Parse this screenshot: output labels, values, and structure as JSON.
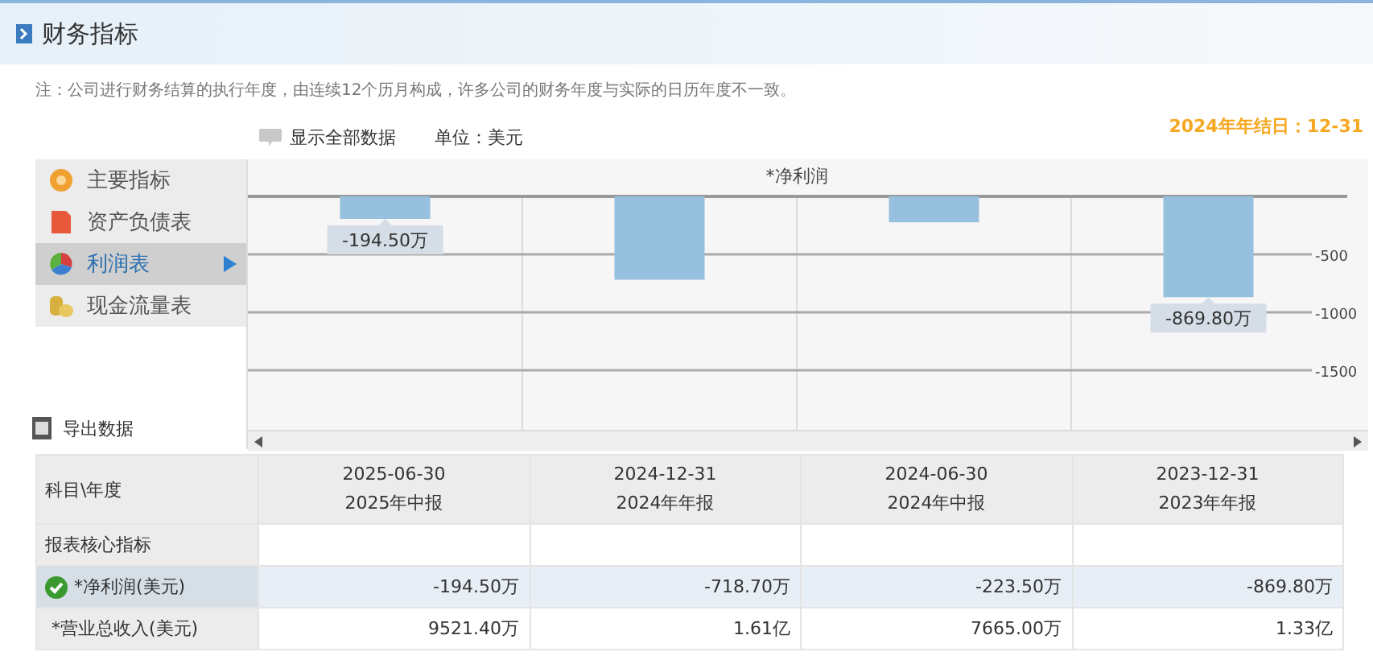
{
  "header": {
    "title": "财务指标"
  },
  "note": "注：公司进行财务结算的执行年度，由连续12个历月构成，许多公司的财务年度与实际的日历年度不一致。",
  "toolbar": {
    "show_all": "显示全部数据",
    "unit": "单位：美元",
    "year_end": "2024年年结日：12-31"
  },
  "sidebar": {
    "items": [
      {
        "label": "主要指标",
        "selected": false
      },
      {
        "label": "资产负债表",
        "selected": false
      },
      {
        "label": "利润表",
        "selected": true
      },
      {
        "label": "现金流量表",
        "selected": false
      }
    ],
    "export": "导出数据"
  },
  "chart": {
    "chart_data": {
      "type": "bar",
      "grid": true,
      "title": "*净利润",
      "values": [
        -194.5,
        -718.7,
        -223.5,
        -869.8
      ],
      "ylim": [
        -2000,
        0
      ],
      "yticks": [
        -500,
        -1000,
        -1500
      ],
      "value_labels": [
        "-194.50万",
        null,
        null,
        "-869.80万"
      ]
    }
  },
  "table": {
    "corner": "科目\\年度",
    "columns": [
      {
        "date": "2025-06-30",
        "period": "2025年中报"
      },
      {
        "date": "2024-12-31",
        "period": "2024年年报"
      },
      {
        "date": "2024-06-30",
        "period": "2024年中报"
      },
      {
        "date": "2023-12-31",
        "period": "2023年年报"
      }
    ],
    "rows": [
      {
        "kind": "section",
        "label": "报表核心指标"
      },
      {
        "kind": "data",
        "label": "*净利润(美元)",
        "checked": true,
        "values": [
          "-194.50万",
          "-718.70万",
          "-223.50万",
          "-869.80万"
        ]
      },
      {
        "kind": "data",
        "label": "*营业总收入(美元)",
        "checked": false,
        "values": [
          "9521.40万",
          "1.61亿",
          "7665.00万",
          "1.33亿"
        ]
      }
    ]
  }
}
